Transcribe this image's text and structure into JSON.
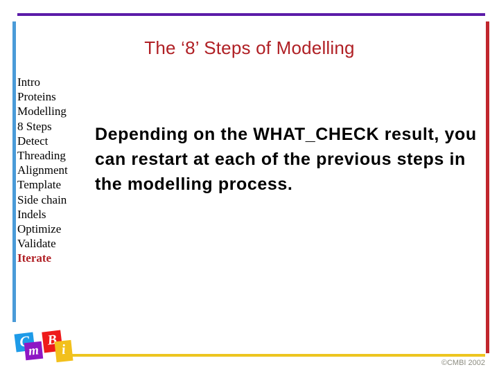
{
  "slide": {
    "title": "The ‘8’ Steps of Modelling",
    "body_text": "Depending on the WHAT_CHECK result, you can restart at each of the previous steps in the modelling process."
  },
  "sidebar": {
    "items": [
      {
        "label": "Intro",
        "active": false
      },
      {
        "label": "Proteins",
        "active": false
      },
      {
        "label": "Modelling",
        "active": false
      },
      {
        "label": "8 Steps",
        "active": false
      },
      {
        "label": "Detect",
        "active": false
      },
      {
        "label": "Threading",
        "active": false
      },
      {
        "label": "Alignment",
        "active": false
      },
      {
        "label": "Template",
        "active": false
      },
      {
        "label": "Side chain",
        "active": false
      },
      {
        "label": "Indels",
        "active": false
      },
      {
        "label": "Optimize",
        "active": false
      },
      {
        "label": "Validate",
        "active": false
      },
      {
        "label": "Iterate",
        "active": true
      }
    ]
  },
  "logo": {
    "tiles": [
      {
        "letter": "C",
        "color": "#1E9BE8"
      },
      {
        "letter": "m",
        "color": "#8E17C4"
      },
      {
        "letter": "B",
        "color": "#EE1B1B"
      },
      {
        "letter": "i",
        "color": "#F2C01C"
      }
    ]
  },
  "footer": {
    "copyright": "©CMBI 2002"
  },
  "colors": {
    "top_rule": "#5B1BA8",
    "left_rule": "#4A9BD8",
    "right_rule": "#C1272D",
    "bottom_rule": "#EDC51F",
    "title": "#B02025",
    "active_nav": "#B02025",
    "copyright": "#8C8C80"
  }
}
